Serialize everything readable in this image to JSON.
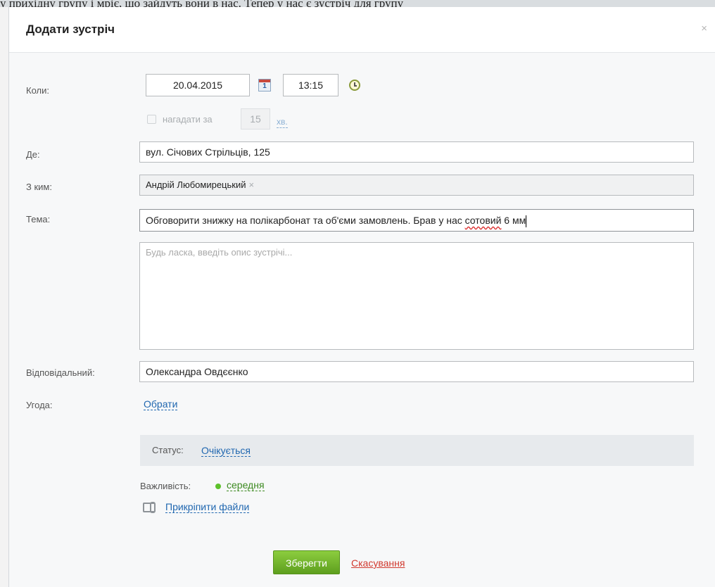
{
  "background": {
    "top_text": "у прихідну групу і мріє, що зайдуть вони в нас. Тепер у нас є зустріч для групу"
  },
  "dialog": {
    "title": "Додати зустріч",
    "close_symbol": "×"
  },
  "form": {
    "when": {
      "label": "Коли:",
      "date": "20.04.2015",
      "time": "13:15",
      "calendar_day": "1",
      "remind_label": "нагадати за",
      "remind_value": "15",
      "remind_unit": "хв."
    },
    "where": {
      "label": "Де:",
      "value": "вул. Січових Стрільців, 125"
    },
    "with_whom": {
      "label": "З ким:",
      "value": "Андрій Любомирецький",
      "remove_symbol": "×"
    },
    "subject": {
      "label": "Тема:",
      "value_part1": "Обговорити знижку на полікарбонат та об'єми замовлень. Брав у нас ",
      "value_misspelled": "сотовий",
      "value_part2": " 6 мм"
    },
    "description": {
      "placeholder": "Будь ласка, введіть опис зустрічі..."
    },
    "responsible": {
      "label": "Відповідальний:",
      "value": "Олександра Овдєєнко"
    },
    "deal": {
      "label": "Угода:",
      "link": "Обрати"
    },
    "status": {
      "label": "Статус:",
      "value": "Очікується"
    },
    "importance": {
      "label": "Важливість:",
      "value": "середня",
      "dot_color": "#5dc12b"
    },
    "attach": {
      "link": "Прикріпити файли"
    }
  },
  "actions": {
    "save": "Зберегти",
    "cancel": "Скасування"
  }
}
